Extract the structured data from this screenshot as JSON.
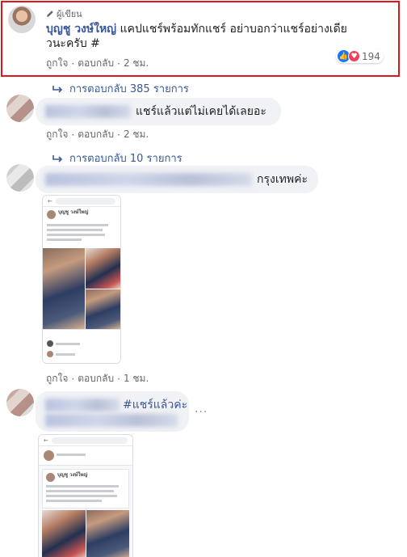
{
  "comment1": {
    "badge": "ผู้เขียน",
    "author": "บุญชู วงษ์ใหญ่",
    "text_line1": " แคปแชร์พร้อมทักแชร์ อย่าบอกว่าแชร์อย่างเดีย",
    "text_line2": "วนะครับ #",
    "like": "ถูกใจ",
    "reply": "ตอบกลับ",
    "sep": "·",
    "time": "2 ชม.",
    "reaction_count": "194",
    "replies_link": "การตอบกลับ 385 รายการ"
  },
  "comment2": {
    "text": "แชร์แล้วแต่ไม่เคยได้เลยอะ",
    "like": "ถูกใจ",
    "reply": "ตอบกลับ",
    "sep": "·",
    "time": "2 ชม.",
    "replies_link": "การตอบกลับ 10 รายการ"
  },
  "comment3": {
    "text": "กรุงเทพค่ะ",
    "like": "ถูกใจ",
    "reply": "ตอบกลับ",
    "sep": "·",
    "time": "1 ชม.",
    "shot_author": "บุญชู วงษ์ใหญ่"
  },
  "comment4": {
    "hashtag": "#แชร์แล้วค่ะ",
    "more": "···",
    "shot_author": "บุญชู วงษ์ใหญ่"
  },
  "colors": {
    "highlight": "#e0161a",
    "link": "#385898",
    "bubble": "#f0f2f5"
  }
}
